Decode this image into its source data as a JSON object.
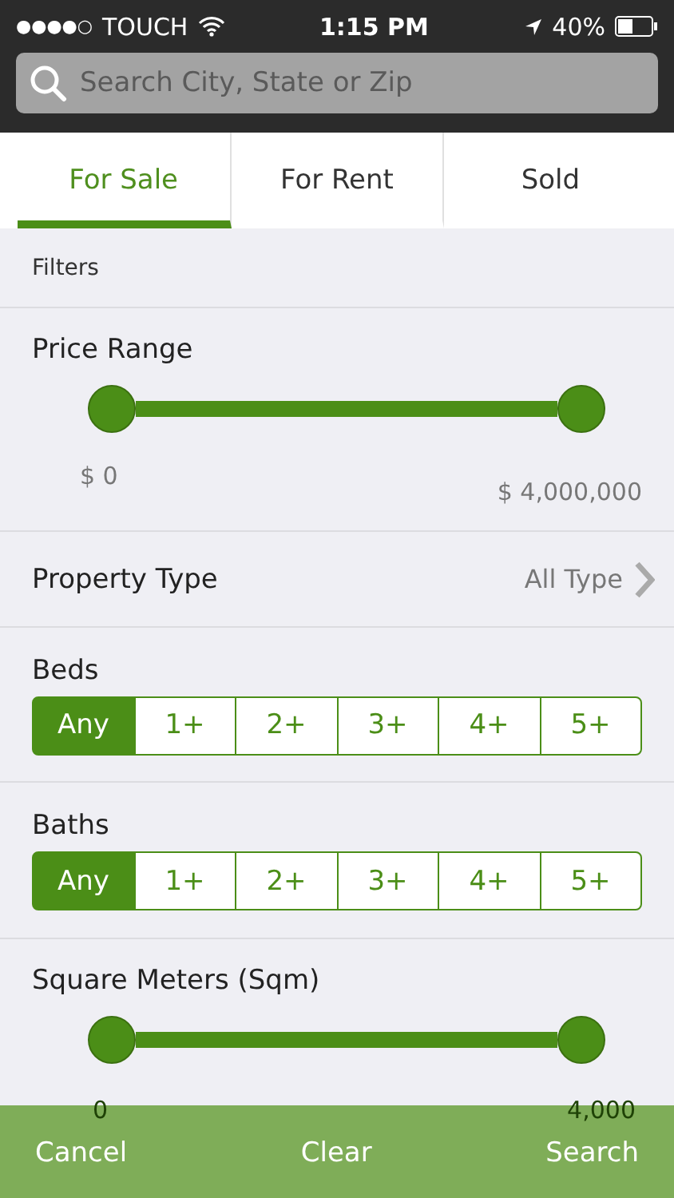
{
  "status_bar": {
    "signal": "●●●●○",
    "carrier": "TOUCH",
    "time": "1:15 PM",
    "battery": "40%"
  },
  "search": {
    "placeholder": "Search City, State or Zip"
  },
  "tabs": [
    {
      "label": "For Sale",
      "selected": true
    },
    {
      "label": "For Rent",
      "selected": false
    },
    {
      "label": "Sold",
      "selected": false
    }
  ],
  "filters_header": "Filters",
  "price_range": {
    "label": "Price Range",
    "min_label": "$ 0",
    "max_label": "$ 4,000,000"
  },
  "property_type": {
    "label": "Property Type",
    "value": "All Type"
  },
  "beds": {
    "label": "Beds",
    "options": [
      {
        "label": "Any",
        "selected": true
      },
      {
        "label": "1+",
        "selected": false
      },
      {
        "label": "2+",
        "selected": false
      },
      {
        "label": "3+",
        "selected": false
      },
      {
        "label": "4+",
        "selected": false
      },
      {
        "label": "5+",
        "selected": false
      }
    ]
  },
  "baths": {
    "label": "Baths",
    "options": [
      {
        "label": "Any",
        "selected": true
      },
      {
        "label": "1+",
        "selected": false
      },
      {
        "label": "2+",
        "selected": false
      },
      {
        "label": "3+",
        "selected": false
      },
      {
        "label": "4+",
        "selected": false
      },
      {
        "label": "5+",
        "selected": false
      }
    ]
  },
  "square_meters": {
    "label": "Square Meters (Sqm)",
    "min_label": "0",
    "max_label": "4,000"
  },
  "footer": {
    "buttons": [
      "Cancel",
      "Clear",
      "Search"
    ]
  }
}
